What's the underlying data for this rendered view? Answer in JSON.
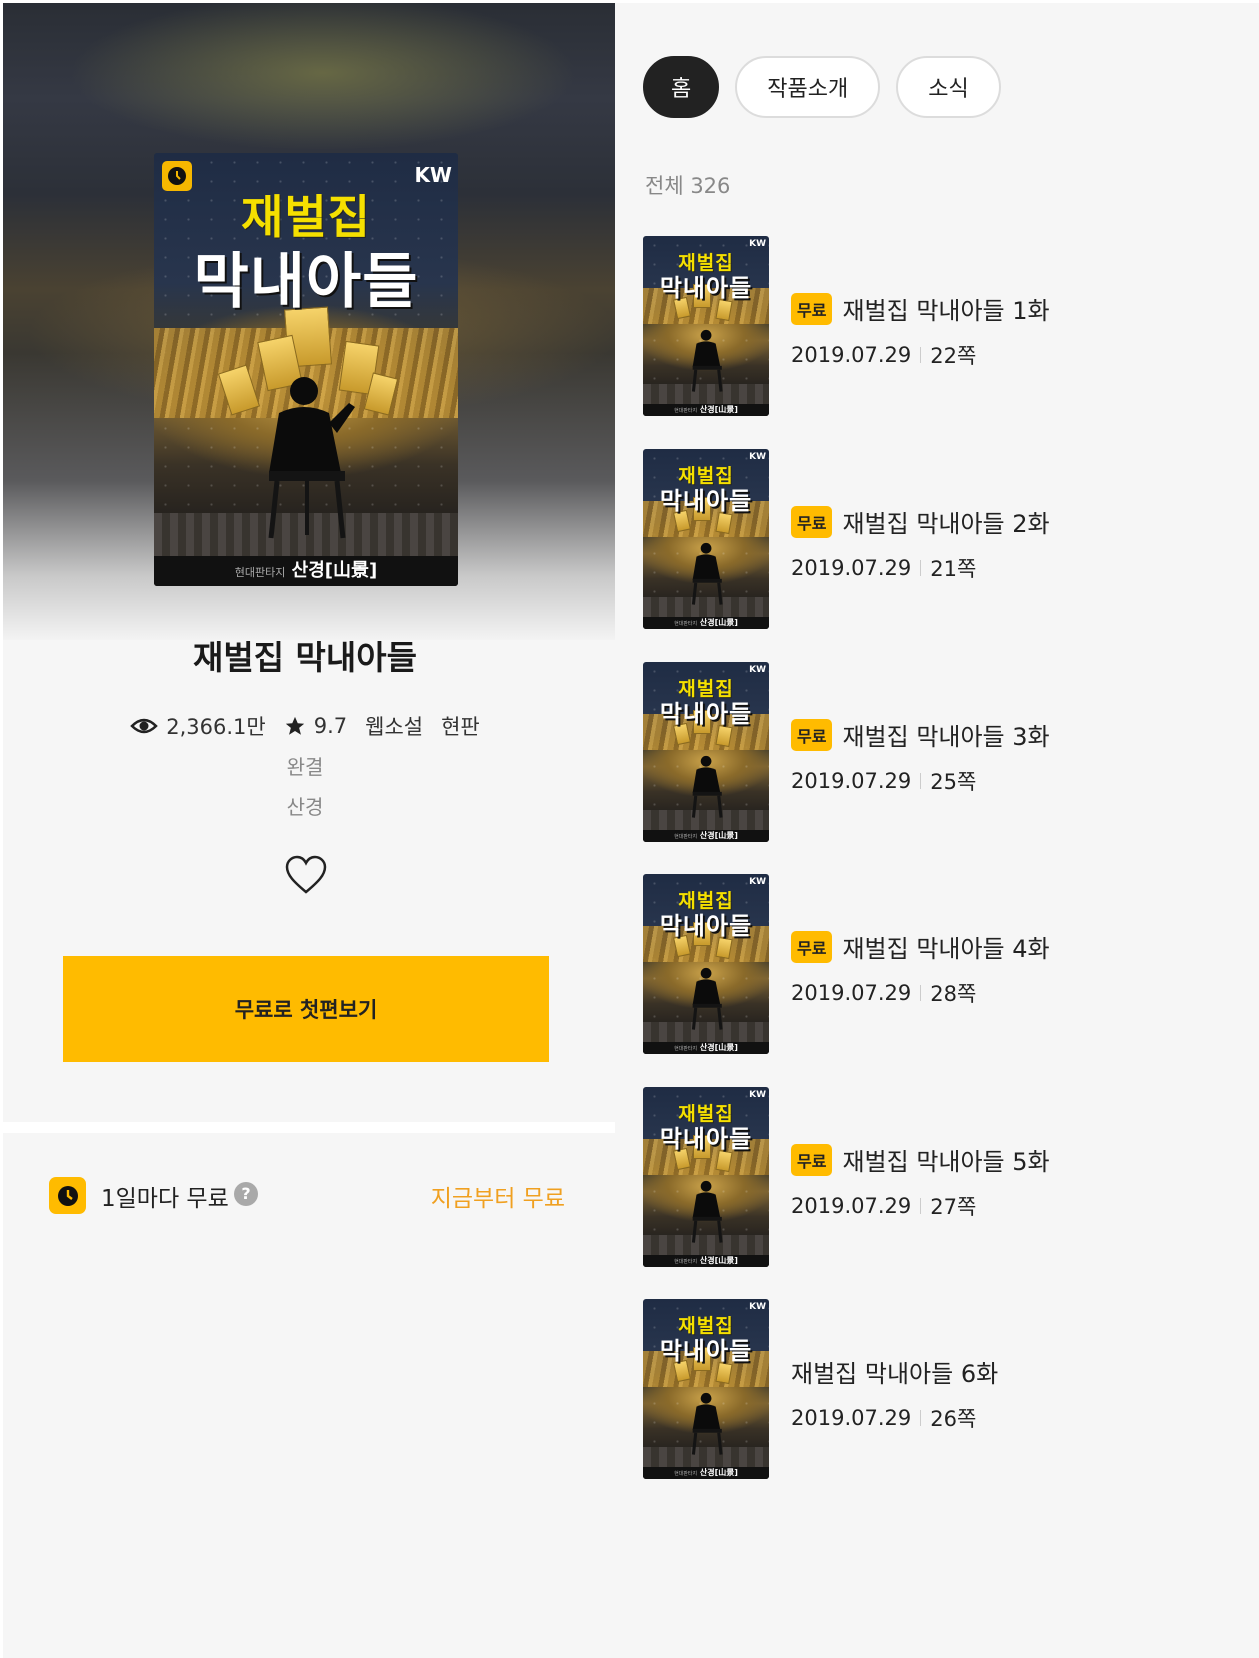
{
  "book": {
    "title": "재벌집 막내아들",
    "views": "2,366.1만",
    "rating": "9.7",
    "category": "웹소설",
    "genre": "현판",
    "status": "완결",
    "author": "산경",
    "cta_label": "무료로 첫편보기"
  },
  "cover": {
    "title_line1": "재벌집",
    "title_line2": "막내아들",
    "publisher_mark": "KW",
    "caption_small": "현대판타지",
    "caption_author": "산경[山景]"
  },
  "free_policy": {
    "label": "1일마다 무료",
    "help": "?",
    "action": "지금부터 무료"
  },
  "tabs": [
    {
      "label": "홈",
      "active": true
    },
    {
      "label": "작품소개",
      "active": false
    },
    {
      "label": "소식",
      "active": false
    }
  ],
  "episode_count": "전체 326",
  "episodes": [
    {
      "free": "무료",
      "title": "재벌집 막내아들 1화",
      "date": "2019.07.29",
      "pages": "22쪽"
    },
    {
      "free": "무료",
      "title": "재벌집 막내아들 2화",
      "date": "2019.07.29",
      "pages": "21쪽"
    },
    {
      "free": "무료",
      "title": "재벌집 막내아들 3화",
      "date": "2019.07.29",
      "pages": "25쪽"
    },
    {
      "free": "무료",
      "title": "재벌집 막내아들 4화",
      "date": "2019.07.29",
      "pages": "28쪽"
    },
    {
      "free": "무료",
      "title": "재벌집 막내아들 5화",
      "date": "2019.07.29",
      "pages": "27쪽"
    },
    {
      "free": "",
      "title": "재벌집 막내아들 6화",
      "date": "2019.07.29",
      "pages": "26쪽"
    }
  ],
  "colors": {
    "accent": "#ffbb00",
    "link": "#f0a020",
    "tab_active": "#222222",
    "panel_bg": "#f6f6f6"
  }
}
